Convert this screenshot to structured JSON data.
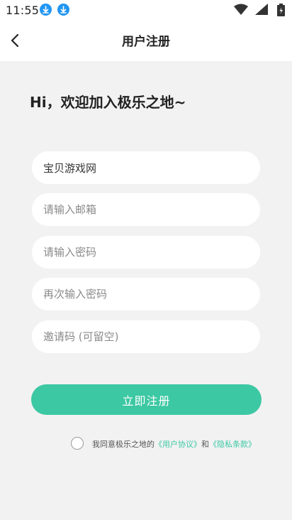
{
  "status_bar": {
    "time": "11:55",
    "icons": [
      "download-icon",
      "download-icon",
      "wifi-icon",
      "cell-signal-icon",
      "battery-icon"
    ]
  },
  "app_bar": {
    "title": "用户注册",
    "back_icon": "back-arrow-icon"
  },
  "greeting": "Hi，欢迎加入极乐之地~",
  "form": {
    "username_value": "宝贝游戏网",
    "email_placeholder": "请输入邮箱",
    "password_placeholder": "请输入密码",
    "confirm_placeholder": "再次输入密码",
    "invite_placeholder": "邀请码 (可留空)"
  },
  "submit_label": "立即注册",
  "agreement": {
    "prefix": "我同意极乐之地的",
    "user_agreement": "《用户协议》",
    "and": "和",
    "privacy_policy": "《隐私条款》"
  },
  "colors": {
    "accent": "#3cc8a2",
    "background": "#f2f2f2",
    "status_icon": "#2196f3"
  }
}
